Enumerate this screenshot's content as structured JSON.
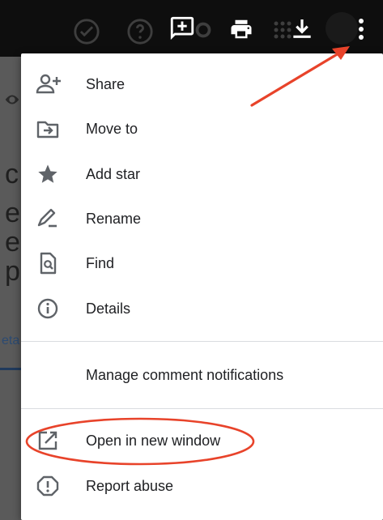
{
  "menu": {
    "items": [
      {
        "label": "Share",
        "icon": "person-add-icon"
      },
      {
        "label": "Move to",
        "icon": "move-to-folder-icon"
      },
      {
        "label": "Add star",
        "icon": "star-icon"
      },
      {
        "label": "Rename",
        "icon": "rename-pen-icon"
      },
      {
        "label": "Find",
        "icon": "find-in-page-icon"
      },
      {
        "label": "Details",
        "icon": "info-icon"
      }
    ],
    "manage_notifications": "Manage comment notifications",
    "open_new_window": "Open in new window",
    "report_abuse": "Report abuse"
  },
  "toolbar": {
    "icons": [
      "add-comment-icon",
      "print-icon",
      "apps-grid-icon",
      "download-icon",
      "more-vert-icon"
    ]
  },
  "background": {
    "link_fragment": "eta"
  },
  "colors": {
    "annotation": "#e8432a",
    "menu_icon": "#5f6368",
    "menu_text": "#202124"
  }
}
